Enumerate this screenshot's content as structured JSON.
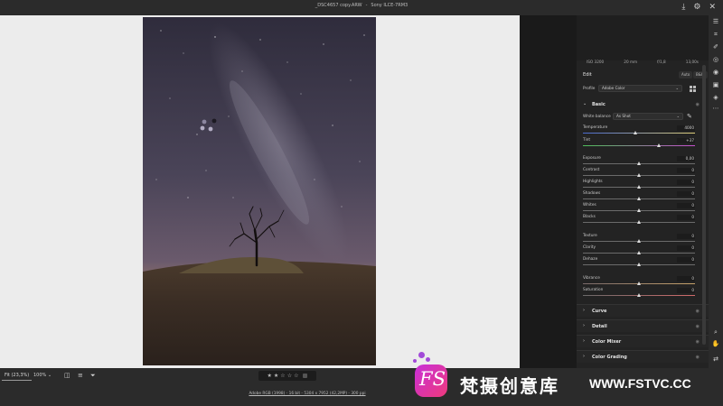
{
  "window": {
    "filename": "_DSC4657 copy.ARW",
    "camera": "Sony ILCE-7RM3"
  },
  "exif": [
    "ISO 3200",
    "20 mm",
    "f/1,8",
    "13,00s"
  ],
  "edit": {
    "title": "Edit",
    "auto_label": "Auto",
    "bw_label": "B&W",
    "profile_label": "Profile",
    "profile_value": "Adobe Color"
  },
  "basic": {
    "title": "Basic",
    "white_balance_label": "White balance",
    "white_balance_value": "As Shot",
    "sliders": [
      {
        "label": "Temperature",
        "value": "4000",
        "pos": 0.47
      },
      {
        "label": "Tint",
        "value": "+37",
        "pos": 0.68
      },
      {
        "label": "Exposure",
        "value": "0,00",
        "pos": 0.5
      },
      {
        "label": "Contrast",
        "value": "0",
        "pos": 0.5
      },
      {
        "label": "Highlights",
        "value": "0",
        "pos": 0.5
      },
      {
        "label": "Shadows",
        "value": "0",
        "pos": 0.5
      },
      {
        "label": "Whites",
        "value": "0",
        "pos": 0.5
      },
      {
        "label": "Blacks",
        "value": "0",
        "pos": 0.5
      },
      {
        "label": "Texture",
        "value": "0",
        "pos": 0.5
      },
      {
        "label": "Clarity",
        "value": "0",
        "pos": 0.5
      },
      {
        "label": "Dehaze",
        "value": "0",
        "pos": 0.5
      },
      {
        "label": "Vibrance",
        "value": "0",
        "pos": 0.5
      },
      {
        "label": "Saturation",
        "value": "0",
        "pos": 0.5
      }
    ]
  },
  "sections": [
    "Curve",
    "Detail",
    "Color Mixer",
    "Color Grading"
  ],
  "statusbar": {
    "fit_label": "Fit (23,3%)",
    "zoom_value": "100%",
    "file_info": "Adobe RGB (1998) - 16 bit - 5304 x 7952 (42,2MP) - 300 ppi",
    "rating": 2
  },
  "watermark": {
    "badge": "FS",
    "text_cn": "梵摄创意库",
    "url": "WWW.FSTVC.CC"
  },
  "colors": {
    "accent": "#c82fd8",
    "panel": "#232323",
    "canvas": "#ececec"
  }
}
